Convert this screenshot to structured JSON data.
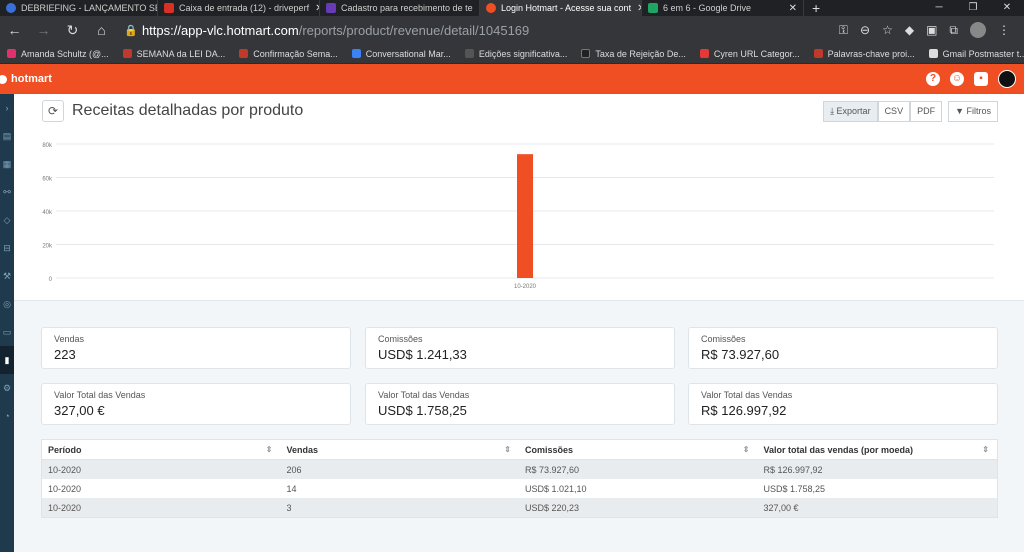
{
  "browser": {
    "tabs": [
      {
        "title": "DEBRIEFING - LANÇAMENTO SE",
        "color": "#3b6fd8"
      },
      {
        "title": "Caixa de entrada (12) - driveperf",
        "color": "#d93025"
      },
      {
        "title": "Cadastro para recebimento de te",
        "color": "#673ab7"
      },
      {
        "title": "Login Hotmart - Acesse sua cont",
        "color": "#f04e23"
      },
      {
        "title": "6 em 6 - Google Drive",
        "color": "#1fa463"
      }
    ],
    "url_host": "https://app-vlc.hotmart.com",
    "url_path": "/reports/product/revenue/detail/1045169",
    "bookmarks": [
      {
        "label": "Amanda Schultz (@...",
        "color": "#e1306c"
      },
      {
        "label": "SEMANA da LEI DA...",
        "color": "#c0392b"
      },
      {
        "label": "Confirmação Sema...",
        "color": "#c0392b"
      },
      {
        "label": "Conversational Mar...",
        "color": "#3b82f6"
      },
      {
        "label": "Edições significativa...",
        "color": "#555555"
      },
      {
        "label": "Taxa de Rejeição De...",
        "color": "#222222"
      },
      {
        "label": "Cyren URL Categor...",
        "color": "#e53935"
      },
      {
        "label": "Palavras-chave proi...",
        "color": "#c0392b"
      },
      {
        "label": "Gmail Postmaster t...",
        "color": "#dddddd"
      }
    ]
  },
  "header": {
    "logo": "hotmart",
    "brand_color": "#f04e23"
  },
  "page": {
    "title": "Receitas detalhadas por produto",
    "export_label": "Exportar",
    "csv_label": "CSV",
    "pdf_label": "PDF",
    "filter_label": "Filtros"
  },
  "chart_data": {
    "type": "bar",
    "categories": [
      "10-2020"
    ],
    "values": [
      73927.6
    ],
    "ylim": [
      0,
      80000
    ],
    "yticks": [
      "0",
      "20k",
      "40k",
      "60k",
      "80k"
    ],
    "ytick_values": [
      0,
      20000,
      40000,
      60000,
      80000
    ],
    "bar_color": "#f04e23",
    "grid": true
  },
  "summary": {
    "sales": [
      {
        "label": "Vendas",
        "value": "223"
      },
      {
        "label": "Comissões",
        "value": "USD$ 1.241,33"
      },
      {
        "label": "Comissões",
        "value": "R$ 73.927,60"
      }
    ],
    "totals": [
      {
        "label": "Valor Total das Vendas",
        "value": "327,00 €"
      },
      {
        "label": "Valor Total das Vendas",
        "value": "USD$ 1.758,25"
      },
      {
        "label": "Valor Total das Vendas",
        "value": "R$ 126.997,92"
      }
    ]
  },
  "table": {
    "headers": [
      "Período",
      "Vendas",
      "Comissões",
      "Valor total das vendas (por moeda)"
    ],
    "rows": [
      [
        "10-2020",
        "206",
        "R$ 73.927,60",
        "R$ 126.997,92"
      ],
      [
        "10-2020",
        "14",
        "USD$ 1.021,10",
        "USD$ 1.758,25"
      ],
      [
        "10-2020",
        "3",
        "USD$ 220,23",
        "327,00 €"
      ]
    ]
  }
}
